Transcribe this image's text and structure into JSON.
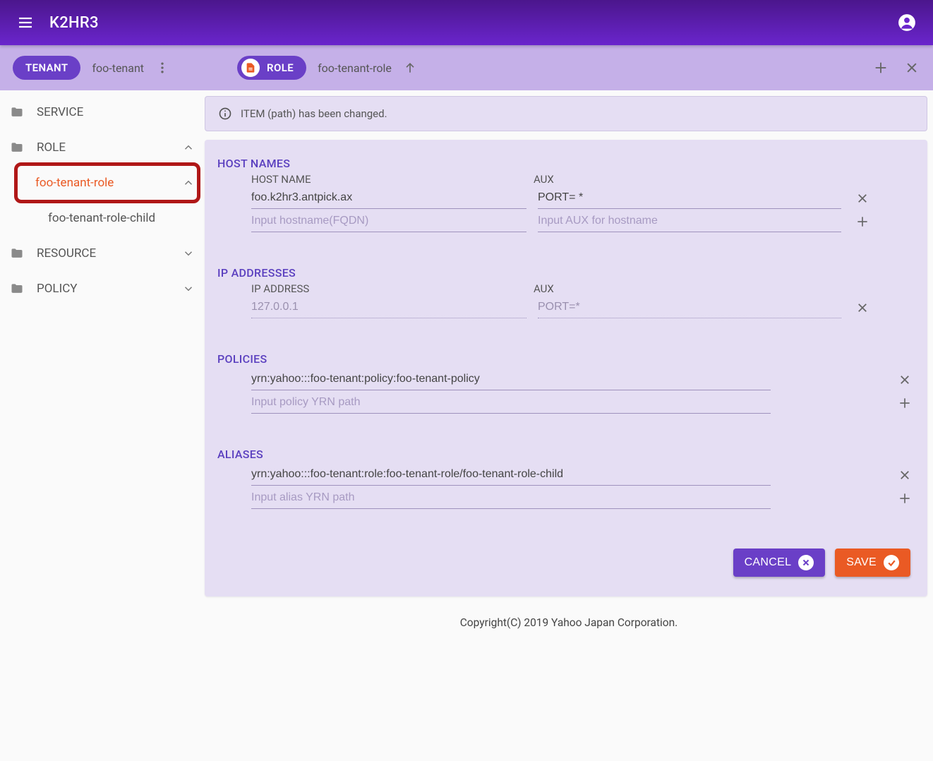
{
  "header": {
    "title": "K2HR3"
  },
  "subheader": {
    "tenant_chip": "TENANT",
    "tenant_name": "foo-tenant",
    "role_chip": "ROLE",
    "role_name": "foo-tenant-role"
  },
  "sidebar": {
    "service": "SERVICE",
    "role": "ROLE",
    "role_child": "foo-tenant-role",
    "role_grandchild": "foo-tenant-role-child",
    "resource": "RESOURCE",
    "policy": "POLICY"
  },
  "notice": "ITEM (path) has been changed.",
  "sections": {
    "hostnames": {
      "title": "HOST NAMES",
      "col1": "HOST NAME",
      "col2": "AUX",
      "rows": [
        {
          "host": "foo.k2hr3.antpick.ax",
          "aux": "PORT= *"
        }
      ],
      "new_host_placeholder": "Input hostname(FQDN)",
      "new_aux_placeholder": "Input AUX for hostname"
    },
    "ips": {
      "title": "IP ADDRESSES",
      "col1": "IP ADDRESS",
      "col2": "AUX",
      "rows": [
        {
          "ip": "127.0.0.1",
          "aux": "PORT=*"
        }
      ]
    },
    "policies": {
      "title": "POLICIES",
      "rows": [
        "yrn:yahoo:::foo-tenant:policy:foo-tenant-policy"
      ],
      "new_placeholder": "Input policy YRN path"
    },
    "aliases": {
      "title": "ALIASES",
      "rows": [
        "yrn:yahoo:::foo-tenant:role:foo-tenant-role/foo-tenant-role-child"
      ],
      "new_placeholder": "Input alias YRN path"
    }
  },
  "buttons": {
    "cancel": "CANCEL",
    "save": "SAVE"
  },
  "footer": "Copyright(C) 2019 Yahoo Japan Corporation."
}
